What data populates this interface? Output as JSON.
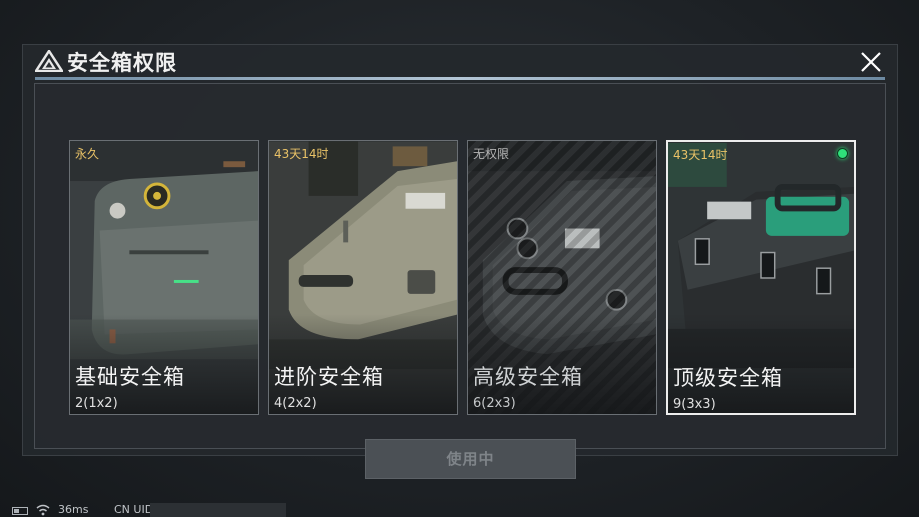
{
  "dialog": {
    "title": "安全箱权限",
    "logo_icon": "triangle-logo-icon",
    "close_icon": "close-icon"
  },
  "cards": [
    {
      "tag": "永久",
      "name": "基础安全箱",
      "size": "2(1x2)",
      "selected": false
    },
    {
      "tag": "43天14时",
      "name": "进阶安全箱",
      "size": "4(2x2)",
      "selected": false
    },
    {
      "tag": "无权限",
      "name": "高级安全箱",
      "size": "6(2x3)",
      "selected": false,
      "locked": true
    },
    {
      "tag": "43天14时",
      "name": "顶级安全箱",
      "size": "9(3x3)",
      "selected": true
    }
  ],
  "action_button": {
    "label": "使用中",
    "enabled": false
  },
  "status_bar": {
    "ping": "36ms",
    "region": "CN UID"
  },
  "colors": {
    "tag_gold": "#e9c267",
    "selected_dot": "#2fe07a",
    "divider": "#b3c6d6"
  }
}
